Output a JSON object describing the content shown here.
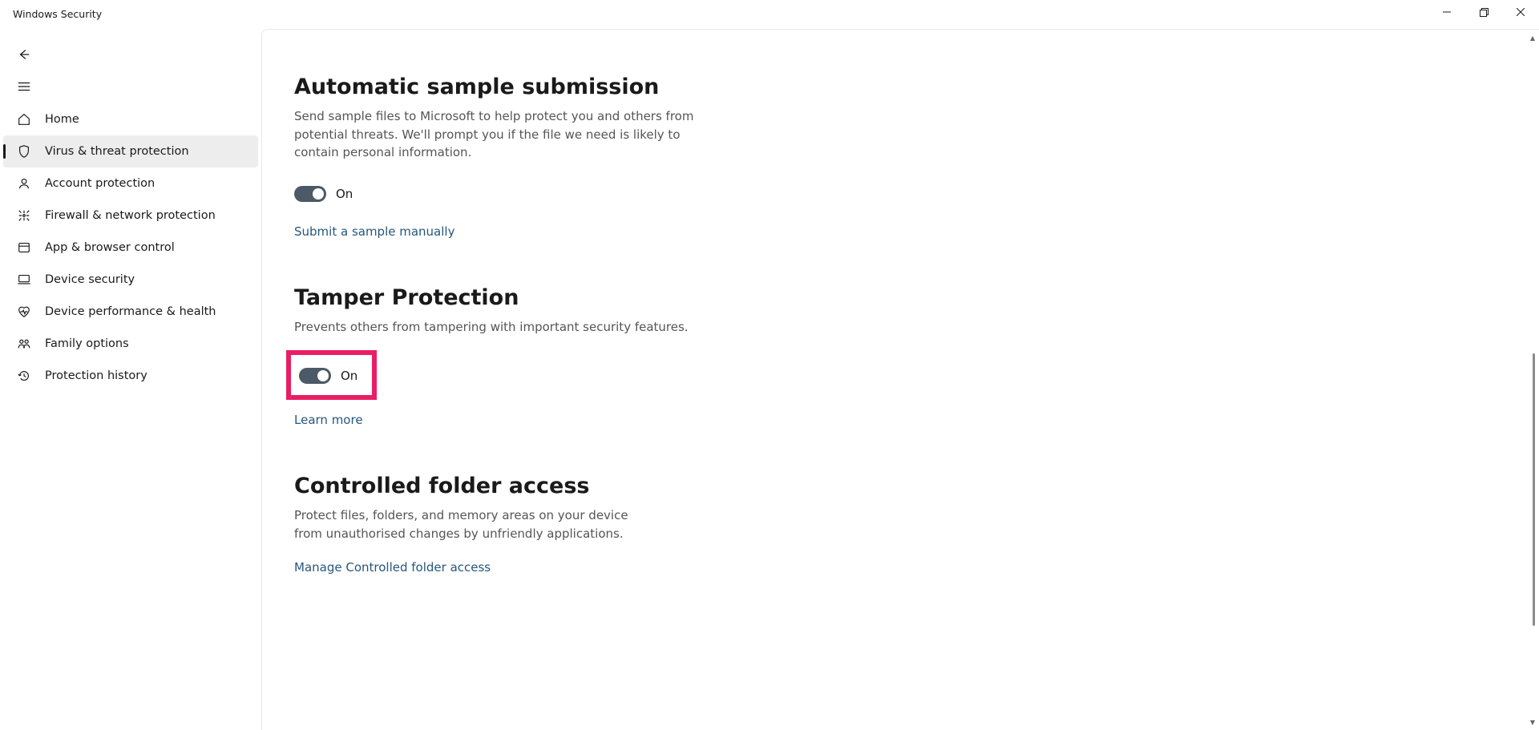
{
  "window": {
    "title": "Windows Security"
  },
  "sidebar": {
    "items": [
      {
        "id": "home",
        "label": "Home"
      },
      {
        "id": "virus",
        "label": "Virus & threat protection"
      },
      {
        "id": "account",
        "label": "Account protection"
      },
      {
        "id": "firewall",
        "label": "Firewall & network protection"
      },
      {
        "id": "appbrw",
        "label": "App & browser control"
      },
      {
        "id": "device",
        "label": "Device security"
      },
      {
        "id": "perf",
        "label": "Device performance & health"
      },
      {
        "id": "family",
        "label": "Family options"
      },
      {
        "id": "history",
        "label": "Protection history"
      }
    ],
    "selected_id": "virus"
  },
  "sections": {
    "autoSample": {
      "title": "Automatic sample submission",
      "description": "Send sample files to Microsoft to help protect you and others from potential threats. We'll prompt you if the file we need is likely to contain personal information.",
      "toggle_state": "On",
      "link": "Submit a sample manually"
    },
    "tamper": {
      "title": "Tamper Protection",
      "description": "Prevents others from tampering with important security features.",
      "toggle_state": "On",
      "link": "Learn more",
      "highlighted": true
    },
    "cfa": {
      "title": "Controlled folder access",
      "description": "Protect files, folders, and memory areas on your device from unauthorised changes by unfriendly applications.",
      "link": "Manage Controlled folder access"
    }
  }
}
